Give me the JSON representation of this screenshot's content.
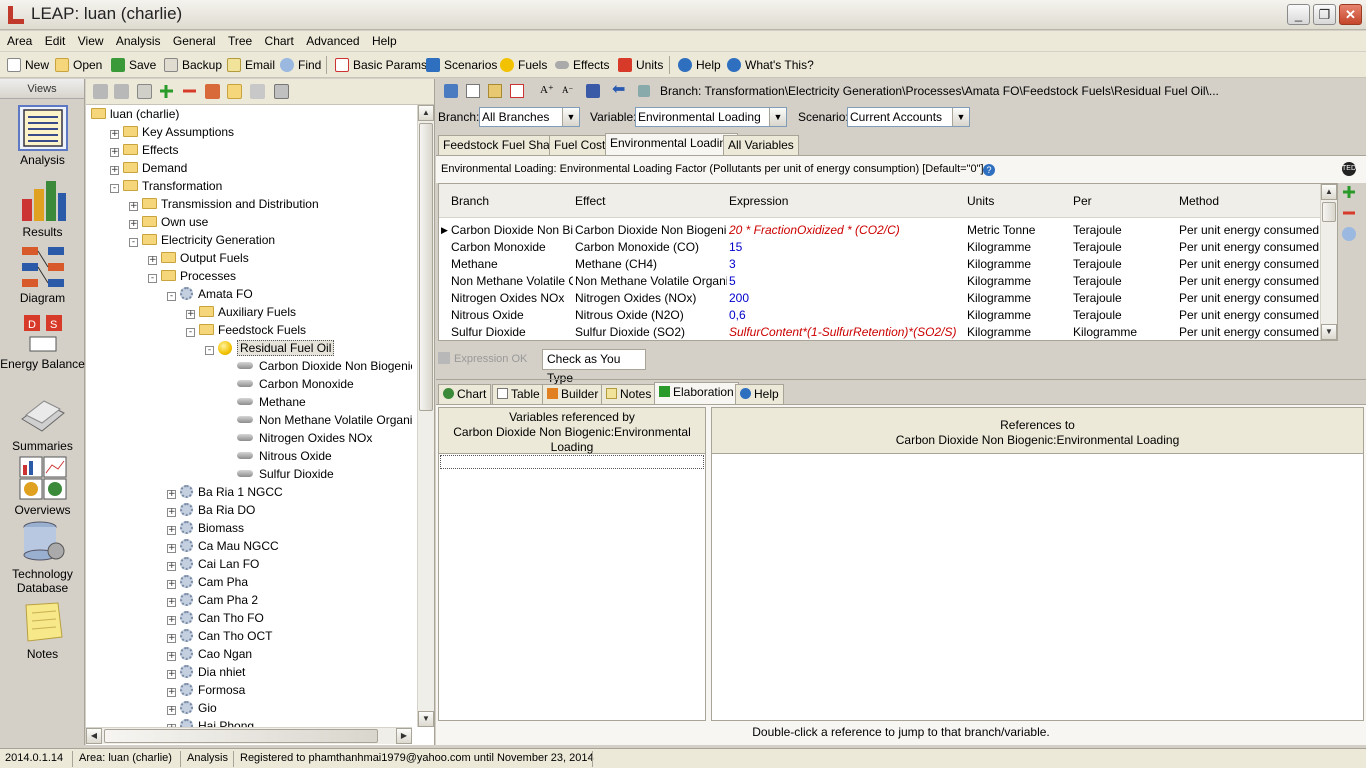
{
  "window": {
    "title": "LEAP: luan (charlie)"
  },
  "menu": [
    "Area",
    "Edit",
    "View",
    "Analysis",
    "General",
    "Tree",
    "Chart",
    "Advanced",
    "Help"
  ],
  "toolbar": {
    "new": "New",
    "open": "Open",
    "save": "Save",
    "backup": "Backup",
    "email": "Email",
    "find": "Find",
    "basic_params": "Basic Params",
    "scenarios": "Scenarios",
    "fuels": "Fuels",
    "effects": "Effects",
    "units": "Units",
    "help": "Help",
    "whats_this": "What's This?"
  },
  "views": {
    "header": "Views",
    "items": [
      {
        "label": "Analysis",
        "icon": "analysis-icon"
      },
      {
        "label": "Results",
        "icon": "results-icon"
      },
      {
        "label": "Diagram",
        "icon": "diagram-icon"
      },
      {
        "label": "Energy Balance",
        "icon": "energy-balance-icon"
      },
      {
        "label": "Summaries",
        "icon": "summaries-icon"
      },
      {
        "label": "Overviews",
        "icon": "overviews-icon"
      },
      {
        "label": "Technology Database",
        "icon": "technology-database-icon"
      },
      {
        "label": "Notes",
        "icon": "notes-icon"
      }
    ]
  },
  "tree": {
    "rows": [
      {
        "label": "luan (charlie)",
        "indent": 0,
        "icon": "folder",
        "exp": ""
      },
      {
        "label": "Key Assumptions",
        "indent": 1,
        "icon": "folder",
        "exp": "+"
      },
      {
        "label": "Effects",
        "indent": 1,
        "icon": "folder",
        "exp": "+"
      },
      {
        "label": "Demand",
        "indent": 1,
        "icon": "folder",
        "exp": "+"
      },
      {
        "label": "Transformation",
        "indent": 1,
        "icon": "folder",
        "exp": "-"
      },
      {
        "label": "Transmission and Distribution",
        "indent": 2,
        "icon": "folder",
        "exp": "+"
      },
      {
        "label": "Own use",
        "indent": 2,
        "icon": "folder",
        "exp": "+"
      },
      {
        "label": "Electricity Generation",
        "indent": 2,
        "icon": "folder",
        "exp": "-"
      },
      {
        "label": "Output Fuels",
        "indent": 3,
        "icon": "folder",
        "exp": "+"
      },
      {
        "label": "Processes",
        "indent": 3,
        "icon": "folder",
        "exp": "-"
      },
      {
        "label": "Amata FO",
        "indent": 4,
        "icon": "gear",
        "exp": "-"
      },
      {
        "label": "Auxiliary Fuels",
        "indent": 5,
        "icon": "folder",
        "exp": "+"
      },
      {
        "label": "Feedstock Fuels",
        "indent": 5,
        "icon": "folder",
        "exp": "-"
      },
      {
        "label": "Residual Fuel Oil",
        "indent": 6,
        "icon": "coin",
        "exp": "-",
        "selected": true
      },
      {
        "label": "Carbon Dioxide Non Biogenic",
        "indent": 7,
        "icon": "pill",
        "exp": ""
      },
      {
        "label": "Carbon Monoxide",
        "indent": 7,
        "icon": "pill",
        "exp": ""
      },
      {
        "label": "Methane",
        "indent": 7,
        "icon": "pill",
        "exp": ""
      },
      {
        "label": "Non Methane Volatile Organic Compounds",
        "indent": 7,
        "icon": "pill",
        "exp": ""
      },
      {
        "label": "Nitrogen Oxides NOx",
        "indent": 7,
        "icon": "pill",
        "exp": ""
      },
      {
        "label": "Nitrous Oxide",
        "indent": 7,
        "icon": "pill",
        "exp": ""
      },
      {
        "label": "Sulfur Dioxide",
        "indent": 7,
        "icon": "pill",
        "exp": ""
      },
      {
        "label": "Ba Ria 1 NGCC",
        "indent": 4,
        "icon": "gear",
        "exp": "+"
      },
      {
        "label": "Ba Ria DO",
        "indent": 4,
        "icon": "gear",
        "exp": "+"
      },
      {
        "label": "Biomass",
        "indent": 4,
        "icon": "gear",
        "exp": "+"
      },
      {
        "label": "Ca Mau NGCC",
        "indent": 4,
        "icon": "gear",
        "exp": "+"
      },
      {
        "label": "Cai Lan FO",
        "indent": 4,
        "icon": "gear",
        "exp": "+"
      },
      {
        "label": "Cam Pha",
        "indent": 4,
        "icon": "gear",
        "exp": "+"
      },
      {
        "label": "Cam Pha 2",
        "indent": 4,
        "icon": "gear",
        "exp": "+"
      },
      {
        "label": "Can Tho FO",
        "indent": 4,
        "icon": "gear",
        "exp": "+"
      },
      {
        "label": "Can Tho OCT",
        "indent": 4,
        "icon": "gear",
        "exp": "+"
      },
      {
        "label": "Cao Ngan",
        "indent": 4,
        "icon": "gear",
        "exp": "+"
      },
      {
        "label": "Dia nhiet",
        "indent": 4,
        "icon": "gear",
        "exp": "+"
      },
      {
        "label": "Formosa",
        "indent": 4,
        "icon": "gear",
        "exp": "+"
      },
      {
        "label": "Gio",
        "indent": 4,
        "icon": "gear",
        "exp": "+"
      },
      {
        "label": "Hai Phong",
        "indent": 4,
        "icon": "gear",
        "exp": "+"
      }
    ]
  },
  "breadcrumb": "Branch: Transformation\\Electricity Generation\\Processes\\Amata FO\\Feedstock Fuels\\Residual Fuel Oil\\...",
  "filters": {
    "branch_label": "Branch:",
    "branch_value": "All Branches",
    "variable_label": "Variable:",
    "variable_value": "Environmental Loading",
    "scenario_label": "Scenario:",
    "scenario_value": "Current Accounts"
  },
  "var_tabs": [
    "Feedstock Fuel Share",
    "Fuel Cost",
    "Environmental Loading",
    "All Variables"
  ],
  "description": "Environmental Loading: Environmental Loading Factor (Pollutants per unit of energy consumption) [Default=\"0\"]",
  "grid": {
    "headers": [
      "Branch",
      "Effect",
      "Expression",
      "Units",
      "Per",
      "Method"
    ],
    "rows": [
      {
        "branch": "Carbon Dioxide Non Biogenic",
        "effect": "Carbon Dioxide Non Biogenic",
        "expression": "20 * FractionOxidized * (CO2/C)",
        "expr_style": "red",
        "units": "Metric Tonne",
        "per": "Terajoule",
        "method": "Per unit energy consumed"
      },
      {
        "branch": "Carbon Monoxide",
        "effect": "Carbon Monoxide (CO)",
        "expression": "15",
        "expr_style": "blue",
        "units": "Kilogramme",
        "per": "Terajoule",
        "method": "Per unit energy consumed"
      },
      {
        "branch": "Methane",
        "effect": "Methane (CH4)",
        "expression": "3",
        "expr_style": "blue",
        "units": "Kilogramme",
        "per": "Terajoule",
        "method": "Per unit energy consumed"
      },
      {
        "branch": "Non Methane Volatile Organic Compounds",
        "effect": "Non Methane Volatile Organic Compounds",
        "expression": "5",
        "expr_style": "blue",
        "units": "Kilogramme",
        "per": "Terajoule",
        "method": "Per unit energy consumed"
      },
      {
        "branch": "Nitrogen Oxides NOx",
        "effect": "Nitrogen Oxides (NOx)",
        "expression": "200",
        "expr_style": "blue",
        "units": "Kilogramme",
        "per": "Terajoule",
        "method": "Per unit energy consumed"
      },
      {
        "branch": "Nitrous Oxide",
        "effect": "Nitrous Oxide (N2O)",
        "expression": "0,6",
        "expr_style": "blue",
        "units": "Kilogramme",
        "per": "Terajoule",
        "method": "Per unit energy consumed"
      },
      {
        "branch": "Sulfur Dioxide",
        "effect": "Sulfur Dioxide (SO2)",
        "expression": "SulfurContent*(1-SulfurRetention)*(SO2/S)",
        "expr_style": "red",
        "units": "Kilogramme",
        "per": "Kilogramme",
        "method": "Per unit energy consumed"
      }
    ]
  },
  "expr_status": {
    "ok": "Expression OK",
    "check": "Check as You Type"
  },
  "bottom_tabs": [
    "Chart",
    "Table",
    "Builder",
    "Notes",
    "Elaboration",
    "Help"
  ],
  "elaboration": {
    "left_header_1": "Variables referenced by",
    "left_header_2": "Carbon Dioxide Non Biogenic:Environmental Loading",
    "right_header_1": "References to",
    "right_header_2": "Carbon Dioxide Non Biogenic:Environmental Loading",
    "hint": "Double-click a reference to jump to that branch/variable."
  },
  "statusbar": {
    "version": "2014.0.1.14",
    "area": "Area: luan (charlie)",
    "view": "Analysis",
    "registered": "Registered to phamthanhmai1979@yahoo.com until November 23, 2014"
  }
}
